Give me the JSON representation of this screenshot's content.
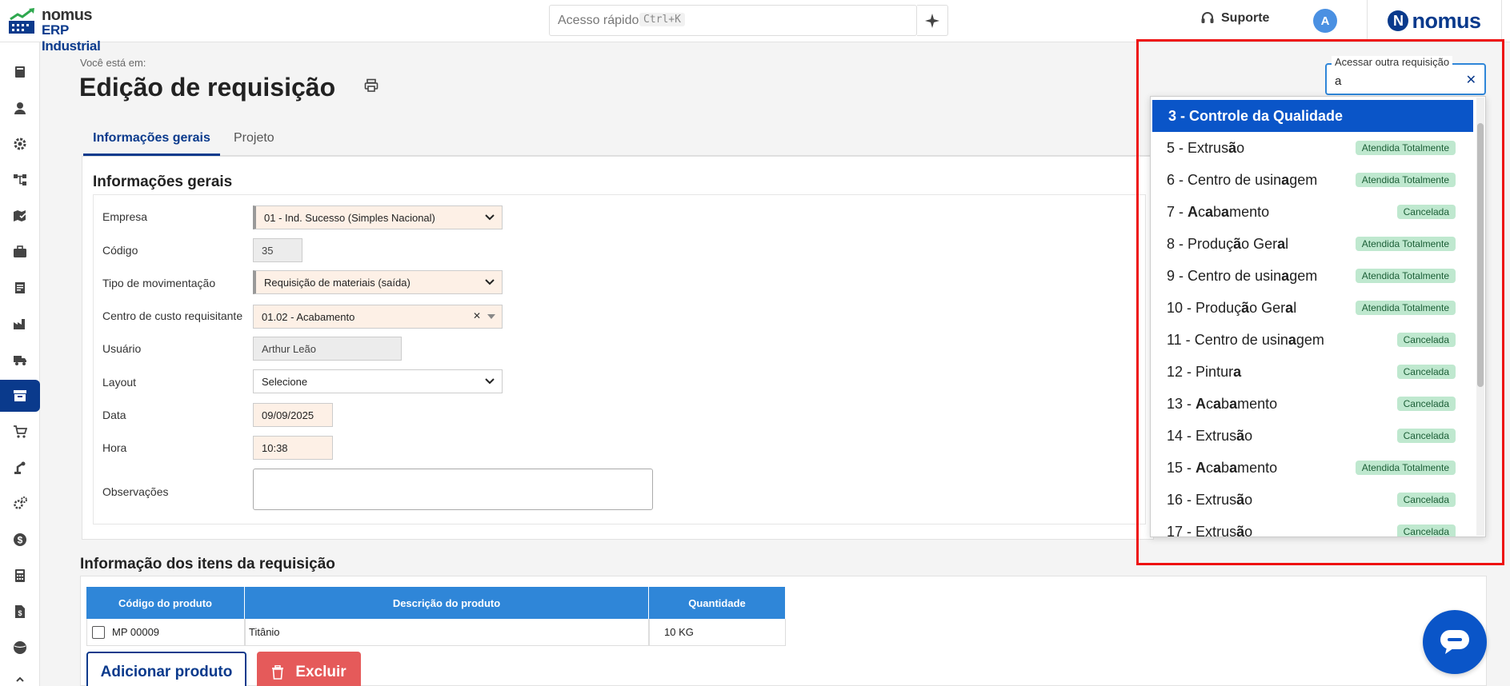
{
  "brand": {
    "logo_line1": "nomus",
    "logo_line2": "ERP Industrial",
    "brand_letter": "N",
    "brand_text": "nomus"
  },
  "topbar": {
    "quick_access": "Acesso rápido",
    "quick_shortcut": "Ctrl+K",
    "support_label": "Suporte",
    "avatar_letter": "A"
  },
  "sidebar": {
    "icons": [
      "book-icon",
      "user-icon",
      "gear-icon",
      "flow-icon",
      "map-check-icon",
      "briefcase-icon",
      "document-icon",
      "factory-icon",
      "truck-icon",
      "archive-icon",
      "cart-icon",
      "robot-arm-icon",
      "gears-icon",
      "dollar-icon",
      "calculator-icon",
      "file-dollar-icon",
      "globe-icon"
    ],
    "active_index": 9
  },
  "page": {
    "breadcrumb": "Você está em:",
    "title": "Edição de requisição"
  },
  "tabs": [
    {
      "label": "Informações gerais",
      "active": true
    },
    {
      "label": "Projeto",
      "active": false
    }
  ],
  "form": {
    "section_title": "Informações gerais",
    "empresa": {
      "label": "Empresa",
      "value": "01 - Ind. Sucesso (Simples Nacional)"
    },
    "codigo": {
      "label": "Código",
      "value": "35"
    },
    "tipo": {
      "label": "Tipo de movimentação",
      "value": "Requisição de materiais (saída)"
    },
    "centro": {
      "label": "Centro de custo requisitante",
      "value": "01.02 - Acabamento"
    },
    "usuario": {
      "label": "Usuário",
      "value": "Arthur Leão"
    },
    "layout": {
      "label": "Layout",
      "value": "Selecione"
    },
    "data": {
      "label": "Data",
      "value": "09/09/2025"
    },
    "hora": {
      "label": "Hora",
      "value": "10:38"
    },
    "obs": {
      "label": "Observações",
      "value": ""
    }
  },
  "items": {
    "title": "Informação dos itens da requisição",
    "headers": [
      "Código do produto",
      "Descrição do produto",
      "Quantidade"
    ],
    "rows": [
      {
        "code": "MP 00009",
        "desc": "Titânio",
        "qty": "10 KG"
      }
    ],
    "add_button": "Adicionar produto",
    "delete_button": "Excluir"
  },
  "access": {
    "label": "Acessar outra requisição",
    "value": "a",
    "options": [
      {
        "text": "3 - Controle da Qualidade",
        "status": "",
        "selected": true
      },
      {
        "text": "5 - Extrusão",
        "status": "Atendida Totalmente"
      },
      {
        "text": "6 - Centro de usinagem",
        "status": "Atendida Totalmente"
      },
      {
        "text": "7 - Acabamento",
        "status": "Cancelada"
      },
      {
        "text": "8 - Produção Geral",
        "status": "Atendida Totalmente"
      },
      {
        "text": "9 - Centro de usinagem",
        "status": "Atendida Totalmente"
      },
      {
        "text": "10 - Produção Geral",
        "status": "Atendida Totalmente"
      },
      {
        "text": "11 - Centro de usinagem",
        "status": "Cancelada"
      },
      {
        "text": "12 - Pintura",
        "status": "Cancelada"
      },
      {
        "text": "13 - Acabamento",
        "status": "Cancelada"
      },
      {
        "text": "14 - Extrusão",
        "status": "Cancelada"
      },
      {
        "text": "15 - Acabamento",
        "status": "Atendida Totalmente"
      },
      {
        "text": "16 - Extrusão",
        "status": "Cancelada"
      },
      {
        "text": "17 - Extrusão",
        "status": "Cancelada"
      }
    ]
  },
  "colors": {
    "primary": "#0a3a8c",
    "accent": "#2f86d8",
    "selected": "#0a55c8",
    "danger": "#e55a5a",
    "badge_bg": "#bfe8cf",
    "highlight": "#ee1111"
  }
}
